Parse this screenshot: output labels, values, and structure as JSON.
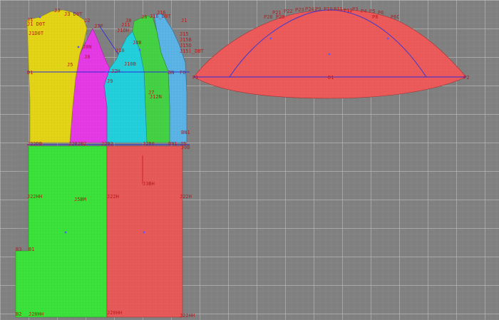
{
  "canvas": {
    "background": "#808080",
    "grid_color": "#cfcfcf",
    "minor_grid_color": "#8f8f8f",
    "baseline_color": "#2a2adc",
    "label_color": "#c01818"
  },
  "pieces": [
    {
      "name": "yellow-bodice-panel",
      "color": "#e3d416"
    },
    {
      "name": "magenta-bodice-panel",
      "color": "#e53ae5"
    },
    {
      "name": "cyan-bodice-panel",
      "color": "#22d0dc"
    },
    {
      "name": "green-bodice-panel",
      "color": "#44d244"
    },
    {
      "name": "blue-bodice-panel",
      "color": "#5ab4e6"
    },
    {
      "name": "sleeve-cap-panel",
      "color": "#ec5a5a"
    },
    {
      "name": "green-skirt-panel",
      "color": "#3ae23a"
    },
    {
      "name": "red-skirt-panel",
      "color": "#e85a5a"
    }
  ],
  "labels": {
    "j1_top": "J1",
    "j3": "J3",
    "j3_top": "J3 D0T",
    "j1_dot": "J1 D0T",
    "j1d_dot": "J1D0T",
    "j2": "J2",
    "j7p": "J7P",
    "j8_top": "J8",
    "j6_top": "J6",
    "j16": "J16",
    "j16_dot": "J16_DBT",
    "j11_top": "J11",
    "j1_right": "J1",
    "j15": "J15",
    "j15b": "J15B",
    "j15d": "J15D",
    "j15l_dot": "J15l_DBT",
    "j1oh": "J1OH",
    "j8b": "J8B",
    "j10": "J10",
    "j10b": "J10B",
    "j5": "J5",
    "j8": "J8",
    "j8n": "J8N",
    "j2h": "J2H",
    "j9": "J9",
    "j7": "J7",
    "j12n": "J12N",
    "d1_left": "D1",
    "bn": "BN",
    "fd": "F0",
    "bn1": "BN1",
    "j22b": "J22DB",
    "j2bs": "J2B2B2",
    "j2b2": "J2B2",
    "j2b0": "J2B0",
    "bn1_j5": "BN1 J5",
    "j0b": "J0B",
    "j22hh_a": "J22HH",
    "j5bm": "J5BM",
    "j22h_mid": "J22H",
    "j3bh": "J3BH",
    "j22h_right": "J22H",
    "b3": "B3",
    "b1": "B1",
    "b2": "B2",
    "j20hh": "J20HH",
    "j20hh2": "J20HH",
    "j22hh_b": "J22HH",
    "p1": "P1",
    "p2": "P2",
    "d1_sleeve": "D1",
    "p21": "P21",
    "p22": "P22",
    "p23": "P23",
    "p24": "P24",
    "p20": "P20",
    "p20d": "P20 P20",
    "p9": "P9",
    "p10": "P10",
    "p11": "P11",
    "p12": "P12",
    "p4": "P4",
    "p5": "P5",
    "p6": "P6",
    "p6c": "P6C",
    "p8": "P8",
    "p3": "P3"
  }
}
